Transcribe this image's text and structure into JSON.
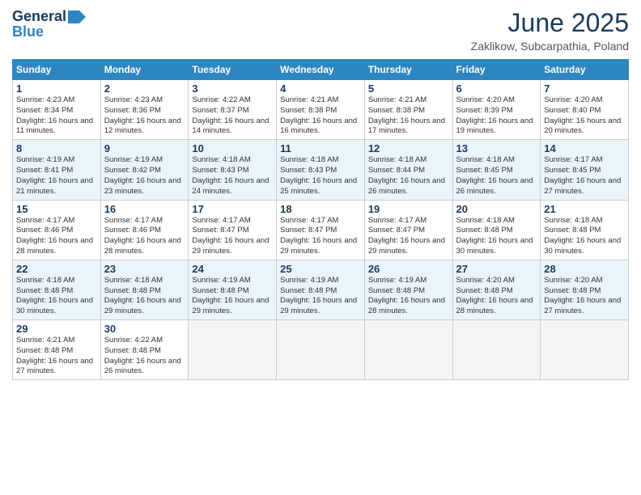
{
  "header": {
    "logo_line1": "General",
    "logo_line2": "Blue",
    "month": "June 2025",
    "location": "Zaklikow, Subcarpathia, Poland"
  },
  "weekdays": [
    "Sunday",
    "Monday",
    "Tuesday",
    "Wednesday",
    "Thursday",
    "Friday",
    "Saturday"
  ],
  "weeks": [
    [
      {
        "num": "1",
        "rise": "4:23 AM",
        "set": "8:34 PM",
        "daylight": "16 hours and 11 minutes."
      },
      {
        "num": "2",
        "rise": "4:23 AM",
        "set": "8:36 PM",
        "daylight": "16 hours and 12 minutes."
      },
      {
        "num": "3",
        "rise": "4:22 AM",
        "set": "8:37 PM",
        "daylight": "16 hours and 14 minutes."
      },
      {
        "num": "4",
        "rise": "4:21 AM",
        "set": "8:38 PM",
        "daylight": "16 hours and 16 minutes."
      },
      {
        "num": "5",
        "rise": "4:21 AM",
        "set": "8:38 PM",
        "daylight": "16 hours and 17 minutes."
      },
      {
        "num": "6",
        "rise": "4:20 AM",
        "set": "8:39 PM",
        "daylight": "16 hours and 19 minutes."
      },
      {
        "num": "7",
        "rise": "4:20 AM",
        "set": "8:40 PM",
        "daylight": "16 hours and 20 minutes."
      }
    ],
    [
      {
        "num": "8",
        "rise": "4:19 AM",
        "set": "8:41 PM",
        "daylight": "16 hours and 21 minutes."
      },
      {
        "num": "9",
        "rise": "4:19 AM",
        "set": "8:42 PM",
        "daylight": "16 hours and 23 minutes."
      },
      {
        "num": "10",
        "rise": "4:18 AM",
        "set": "8:43 PM",
        "daylight": "16 hours and 24 minutes."
      },
      {
        "num": "11",
        "rise": "4:18 AM",
        "set": "8:43 PM",
        "daylight": "16 hours and 25 minutes."
      },
      {
        "num": "12",
        "rise": "4:18 AM",
        "set": "8:44 PM",
        "daylight": "16 hours and 26 minutes."
      },
      {
        "num": "13",
        "rise": "4:18 AM",
        "set": "8:45 PM",
        "daylight": "16 hours and 26 minutes."
      },
      {
        "num": "14",
        "rise": "4:17 AM",
        "set": "8:45 PM",
        "daylight": "16 hours and 27 minutes."
      }
    ],
    [
      {
        "num": "15",
        "rise": "4:17 AM",
        "set": "8:46 PM",
        "daylight": "16 hours and 28 minutes."
      },
      {
        "num": "16",
        "rise": "4:17 AM",
        "set": "8:46 PM",
        "daylight": "16 hours and 28 minutes."
      },
      {
        "num": "17",
        "rise": "4:17 AM",
        "set": "8:47 PM",
        "daylight": "16 hours and 29 minutes."
      },
      {
        "num": "18",
        "rise": "4:17 AM",
        "set": "8:47 PM",
        "daylight": "16 hours and 29 minutes."
      },
      {
        "num": "19",
        "rise": "4:17 AM",
        "set": "8:47 PM",
        "daylight": "16 hours and 29 minutes."
      },
      {
        "num": "20",
        "rise": "4:18 AM",
        "set": "8:48 PM",
        "daylight": "16 hours and 30 minutes."
      },
      {
        "num": "21",
        "rise": "4:18 AM",
        "set": "8:48 PM",
        "daylight": "16 hours and 30 minutes."
      }
    ],
    [
      {
        "num": "22",
        "rise": "4:18 AM",
        "set": "8:48 PM",
        "daylight": "16 hours and 30 minutes."
      },
      {
        "num": "23",
        "rise": "4:18 AM",
        "set": "8:48 PM",
        "daylight": "16 hours and 29 minutes."
      },
      {
        "num": "24",
        "rise": "4:19 AM",
        "set": "8:48 PM",
        "daylight": "16 hours and 29 minutes."
      },
      {
        "num": "25",
        "rise": "4:19 AM",
        "set": "8:48 PM",
        "daylight": "16 hours and 29 minutes."
      },
      {
        "num": "26",
        "rise": "4:19 AM",
        "set": "8:48 PM",
        "daylight": "16 hours and 28 minutes."
      },
      {
        "num": "27",
        "rise": "4:20 AM",
        "set": "8:48 PM",
        "daylight": "16 hours and 28 minutes."
      },
      {
        "num": "28",
        "rise": "4:20 AM",
        "set": "8:48 PM",
        "daylight": "16 hours and 27 minutes."
      }
    ],
    [
      {
        "num": "29",
        "rise": "4:21 AM",
        "set": "8:48 PM",
        "daylight": "16 hours and 27 minutes."
      },
      {
        "num": "30",
        "rise": "4:22 AM",
        "set": "8:48 PM",
        "daylight": "16 hours and 26 minutes."
      },
      null,
      null,
      null,
      null,
      null
    ]
  ],
  "labels": {
    "sunrise": "Sunrise:",
    "sunset": "Sunset:",
    "daylight": "Daylight:"
  }
}
